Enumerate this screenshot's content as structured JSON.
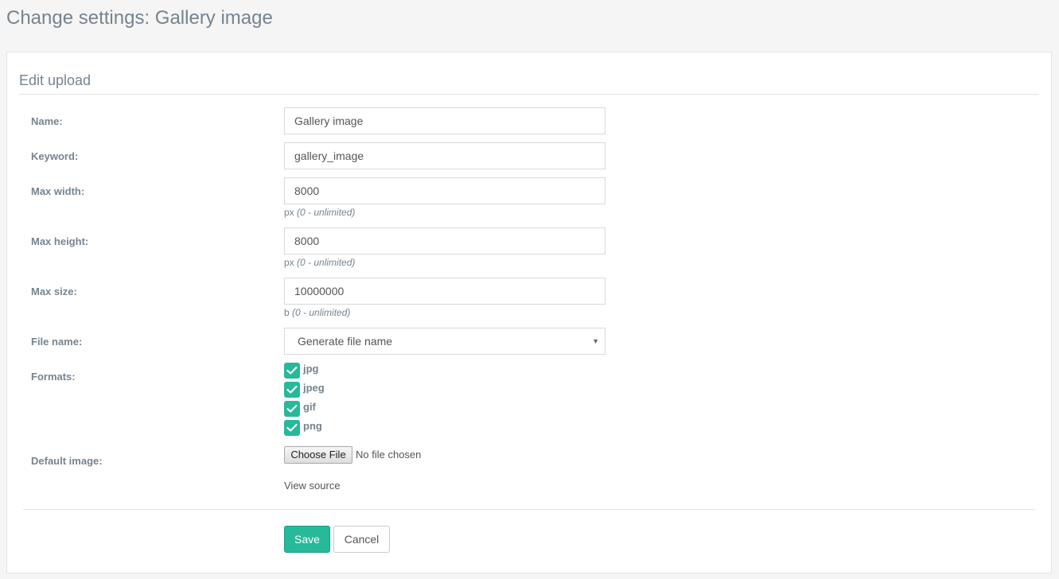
{
  "page": {
    "title": "Change settings: Gallery image"
  },
  "form": {
    "legend": "Edit upload",
    "name": {
      "label": "Name:",
      "value": "Gallery image"
    },
    "keyword": {
      "label": "Keyword:",
      "value": "gallery_image"
    },
    "max_width": {
      "label": "Max width:",
      "value": "8000",
      "unit": "px",
      "hint": "(0 - unlimited)"
    },
    "max_height": {
      "label": "Max height:",
      "value": "8000",
      "unit": "px",
      "hint": "(0 - unlimited)"
    },
    "max_size": {
      "label": "Max size:",
      "value": "10000000",
      "unit": "b",
      "hint": "(0 - unlimited)"
    },
    "file_name": {
      "label": "File name:",
      "selected": "Generate file name"
    },
    "formats": {
      "label": "Formats:",
      "items": [
        {
          "label": "jpg",
          "checked": true
        },
        {
          "label": "jpeg",
          "checked": true
        },
        {
          "label": "gif",
          "checked": true
        },
        {
          "label": "png",
          "checked": true
        }
      ]
    },
    "default_image": {
      "label": "Default image:",
      "button": "Choose File",
      "status": "No file chosen",
      "link": "View source"
    },
    "actions": {
      "save": "Save",
      "cancel": "Cancel"
    }
  },
  "colors": {
    "accent": "#26b99a",
    "label": "#76838f"
  }
}
